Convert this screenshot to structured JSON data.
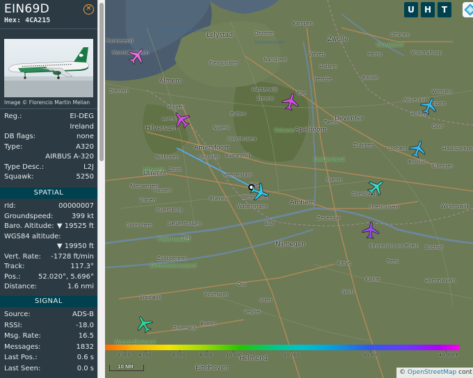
{
  "header": {
    "callsign": "EIN69D",
    "hex_label": "Hex:",
    "hex_value": "4CA215",
    "close_icon": "close-icon"
  },
  "photo": {
    "credit": "Image © Florencio Martin Melian"
  },
  "details": [
    {
      "key": "Reg.:",
      "value": "EI-DEG"
    },
    {
      "key": "",
      "value": "Ireland"
    },
    {
      "key": "DB flags:",
      "value": "none"
    },
    {
      "key": "Type:",
      "value": "A320"
    },
    {
      "key": "",
      "value": "AIRBUS A-320"
    },
    {
      "key": "Type Desc.:",
      "value": "L2J"
    },
    {
      "key": "Squawk:",
      "value": "5250"
    }
  ],
  "spatial": {
    "title": "SPATIAL",
    "rows": [
      {
        "key": "rId:",
        "value": "00000007"
      },
      {
        "key": "Groundspeed:",
        "value": "399 kt"
      },
      {
        "key": "Baro. Altitude:",
        "value": "▼ 19525 ft"
      },
      {
        "key": "WGS84 altitude:",
        "value": ""
      },
      {
        "key": "",
        "value": "▼ 19950 ft"
      },
      {
        "key": "Vert. Rate:",
        "value": "-1728 ft/min"
      },
      {
        "key": "Track:",
        "value": "117.3°"
      },
      {
        "key": "Pos.:",
        "value": "52.020°, 5.696°"
      },
      {
        "key": "Distance:",
        "value": "1.6 nmi"
      }
    ]
  },
  "signal": {
    "title": "SIGNAL",
    "rows": [
      {
        "key": "Source:",
        "value": "ADS-B"
      },
      {
        "key": "RSSI:",
        "value": "-18.0"
      },
      {
        "key": "Msg. Rate:",
        "value": "16.5"
      },
      {
        "key": "Messages:",
        "value": "1832"
      },
      {
        "key": "Last Pos.:",
        "value": "0.6 s"
      },
      {
        "key": "Last Seen:",
        "value": "0.0 s"
      }
    ]
  },
  "map_buttons": [
    "U",
    "H",
    "T"
  ],
  "map_labels": {
    "places": [
      "Purmerend",
      "Monnickendam",
      "Lelystad",
      "Dronten",
      "Kampen",
      "Zwolle",
      "Ommen",
      "Almere",
      "Flevopolder",
      "Nunspeet",
      "Wezep",
      "Heino",
      "Raalte",
      "Vroomshoop",
      "Diemen",
      "Harderwijk",
      "Ermelo",
      "Rijssen",
      "Wierden",
      "Hilversum",
      "Laren",
      "Nijkerk",
      "Apeldoorn",
      "Deventer",
      "Goor",
      "Huizen",
      "Putten",
      "Voorthuizen",
      "Amersfoort",
      "Leusden",
      "Barneveld",
      "Lochem",
      "Haaksbergen",
      "Borculo",
      "Eibergen",
      "Utrecht",
      "Bilthoven",
      "Nieuwegein",
      "Ede",
      "Bennekom",
      "Wageningen",
      "Arnhem",
      "Doesburg",
      "Doetinchem",
      "Winterswijk",
      "Zevenaar",
      "Emmerich am Rhein",
      "Bocholt",
      "Culemborg",
      "Tiel",
      "Nijmegen",
      "Zaltbommel",
      "Kleve",
      "Goch",
      "Kalkar",
      "Hamminkeln",
      "Rees",
      "Rosmalen",
      "Uden",
      "Boxtel",
      "Oss",
      "Waalwijk",
      "Oisterwijk",
      "Veghel",
      "Helmond",
      "Eindhoven",
      "Geldermalsen",
      "Vianen",
      "Gorinchem",
      "Houten",
      "Zeist",
      "Veenendaal",
      "Rhenen",
      "Elst",
      "Epe",
      "Heerde",
      "Twello",
      "Zutphen",
      "Dieren",
      "Hattem",
      "Nijverdal",
      "Holten"
    ],
    "water": [
      "Markermeer & IJmeer",
      "Veluwemeer"
    ],
    "green": [
      "Veluwe",
      "Gelderland",
      "Utrecht",
      "Overijssel",
      "Tielerwaard",
      "Bommelerwaard",
      "Noord-Brabant"
    ]
  },
  "altitude_legend": {
    "ticks": [
      "2 000",
      "4 000",
      "6 000",
      "8 000",
      "10 000",
      "20 000",
      "30 000",
      "40 000+"
    ]
  },
  "scale_label": "10 NM",
  "attribution": {
    "prefix": "©",
    "link": "OpenStreetMap",
    "suffix": "cont"
  },
  "colors": {
    "sidebar_bg": "#2b3a43",
    "section_bg": "#00414f",
    "selected_plane": "#33c9e6",
    "track_line": "#4fb0ff"
  },
  "aircraft": [
    {
      "name": "aircraft-icon-purmerend",
      "color": "#e86ee0"
    },
    {
      "name": "aircraft-icon-hilversum",
      "color": "#d84ce8"
    },
    {
      "name": "aircraft-icon-harderwijk",
      "color": "#d84ce8"
    },
    {
      "name": "aircraft-icon-rijssen",
      "color": "#39b7e8"
    },
    {
      "name": "aircraft-icon-lochem",
      "color": "#39b7e8"
    },
    {
      "name": "aircraft-icon-doesburg",
      "color": "#3ed6c4"
    },
    {
      "name": "aircraft-icon-zevenaar",
      "color": "#9a4cf0"
    },
    {
      "name": "aircraft-icon-boxtel",
      "color": "#2ed49a"
    },
    {
      "name": "aircraft-icon-selected-ein69d",
      "color": "#33c9e6"
    }
  ]
}
